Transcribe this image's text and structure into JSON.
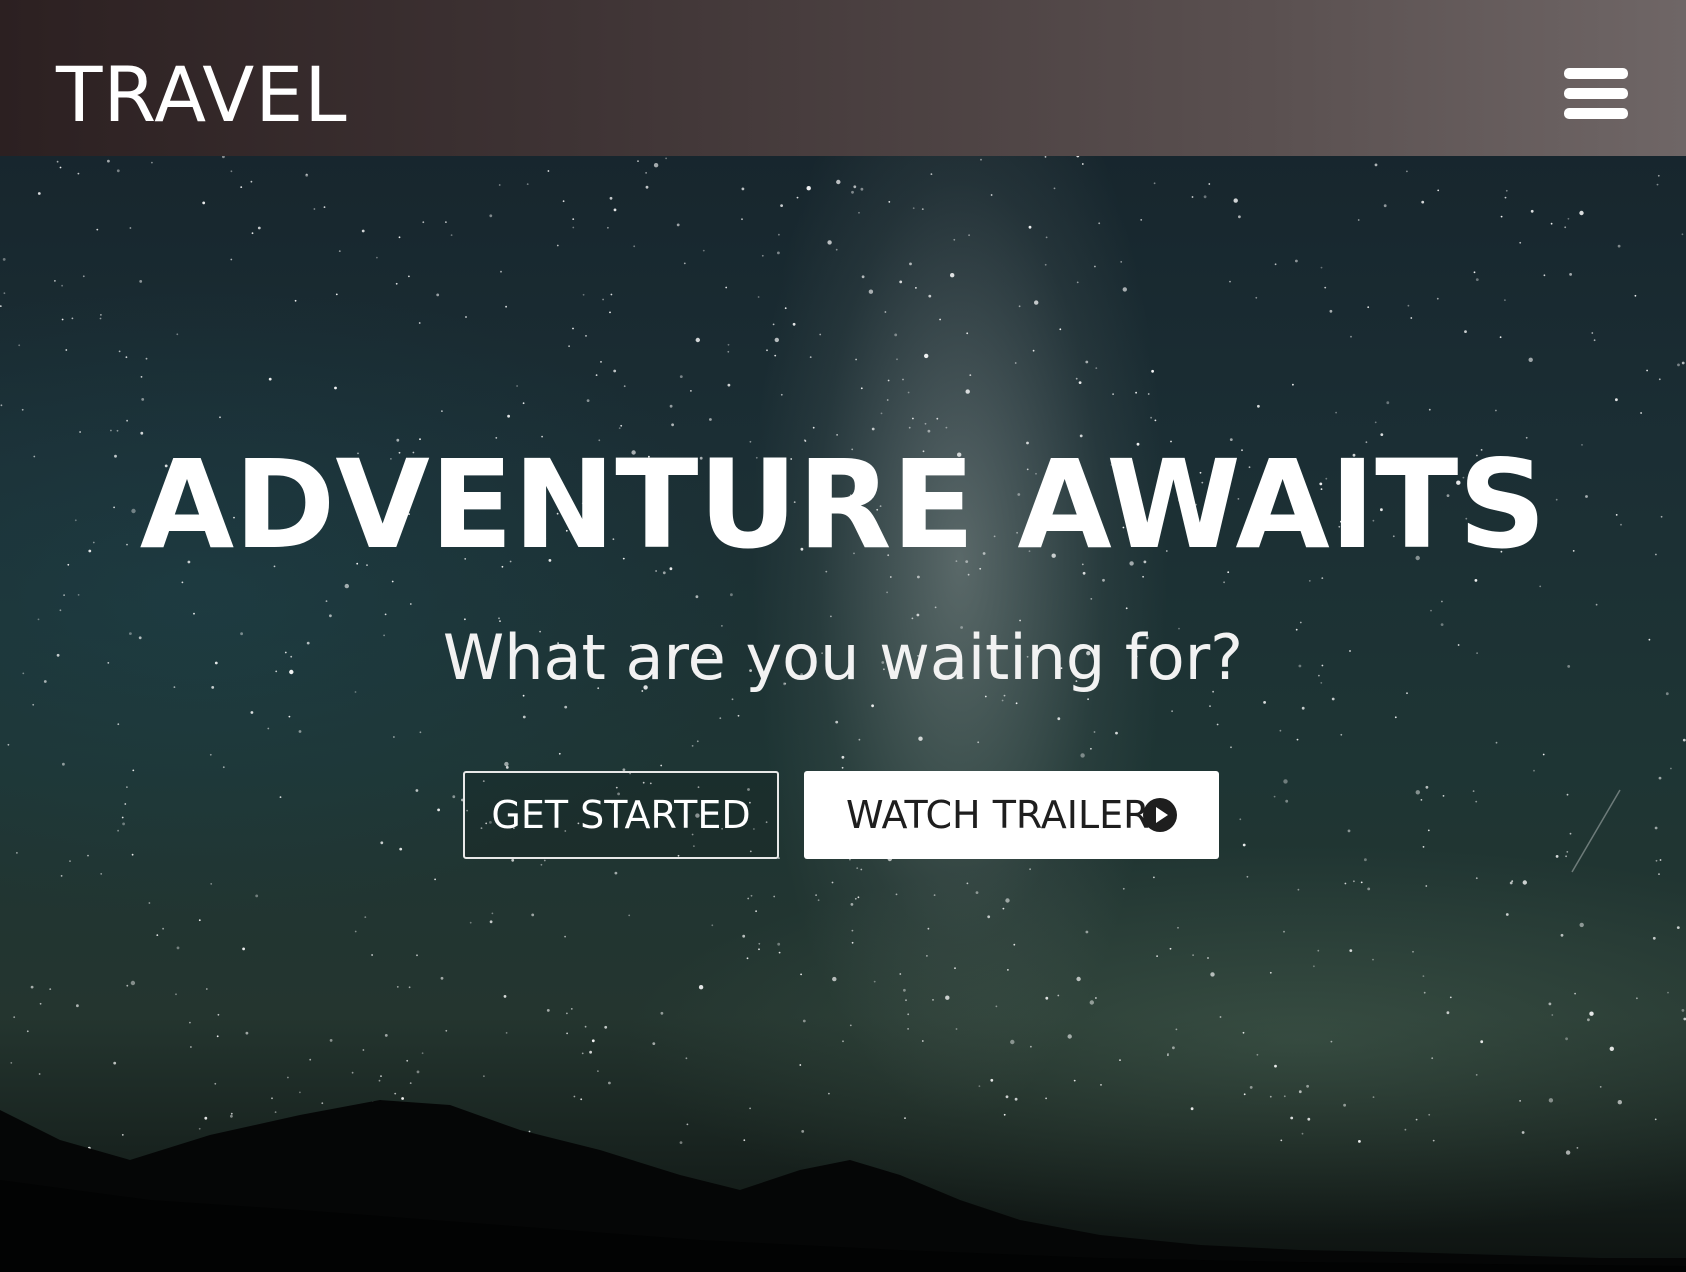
{
  "header": {
    "logo": "TRAVEL",
    "menu_icon": "hamburger-menu-icon"
  },
  "hero": {
    "headline": "ADVENTURE AWAITS",
    "subheadline": "What are you waiting for?",
    "background": "starry-night-sky-milky-way-over-mountains",
    "buttons": {
      "get_started": "GET STARTED",
      "watch_trailer": "WATCH TRAILER",
      "watch_trailer_icon": "play-circle-icon"
    }
  },
  "colors": {
    "header_bg_start": "#2c2021",
    "header_bg_end": "#6f6666",
    "text": "#ffffff",
    "button_dark_text": "#1e1e1e"
  }
}
